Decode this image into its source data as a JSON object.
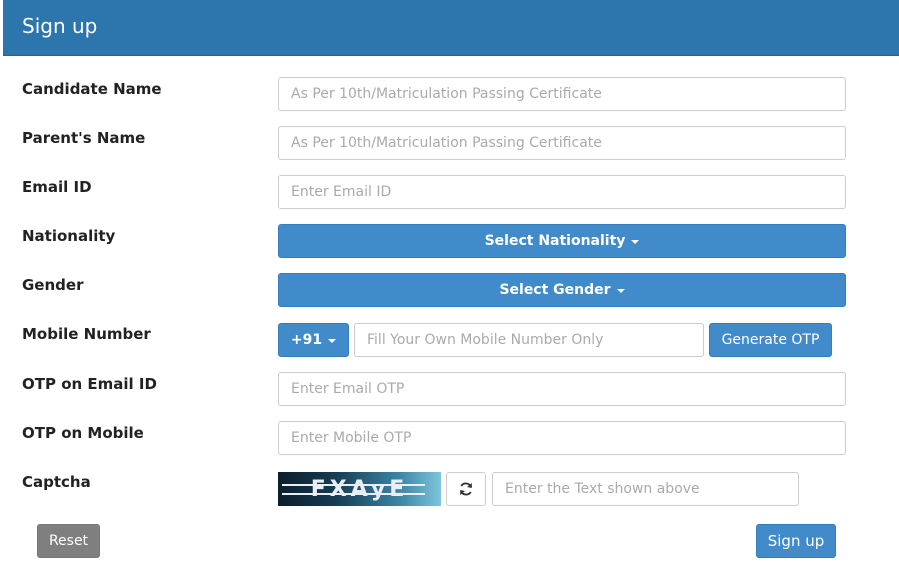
{
  "header": {
    "title": "Sign up"
  },
  "fields": {
    "candidate_name": {
      "label": "Candidate Name",
      "value": "",
      "placeholder": "As Per 10th/Matriculation Passing Certificate"
    },
    "parent_name": {
      "label": "Parent's Name",
      "value": "",
      "placeholder": "As Per 10th/Matriculation Passing Certificate"
    },
    "email": {
      "label": "Email ID",
      "value": "",
      "placeholder": "Enter Email ID"
    },
    "nationality": {
      "label": "Nationality",
      "button_label": "Select Nationality"
    },
    "gender": {
      "label": "Gender",
      "button_label": "Select Gender"
    },
    "mobile": {
      "label": "Mobile Number",
      "country_code": "+91",
      "value": "",
      "placeholder": "Fill Your Own Mobile Number Only",
      "otp_button": "Generate OTP"
    },
    "otp_email": {
      "label": "OTP on Email ID",
      "value": "",
      "placeholder": "Enter Email OTP"
    },
    "otp_mobile": {
      "label": "OTP on Mobile",
      "value": "",
      "placeholder": "Enter Mobile OTP"
    },
    "captcha": {
      "label": "Captcha",
      "image_text": "FXAyE",
      "value": "",
      "placeholder": "Enter the Text shown above",
      "refresh_icon": "refresh-icon"
    }
  },
  "actions": {
    "reset_label": "Reset",
    "signup_label": "Sign up"
  },
  "colors": {
    "header": "#2d76ad",
    "primary": "#428bca",
    "reset": "#7f7f7f"
  }
}
